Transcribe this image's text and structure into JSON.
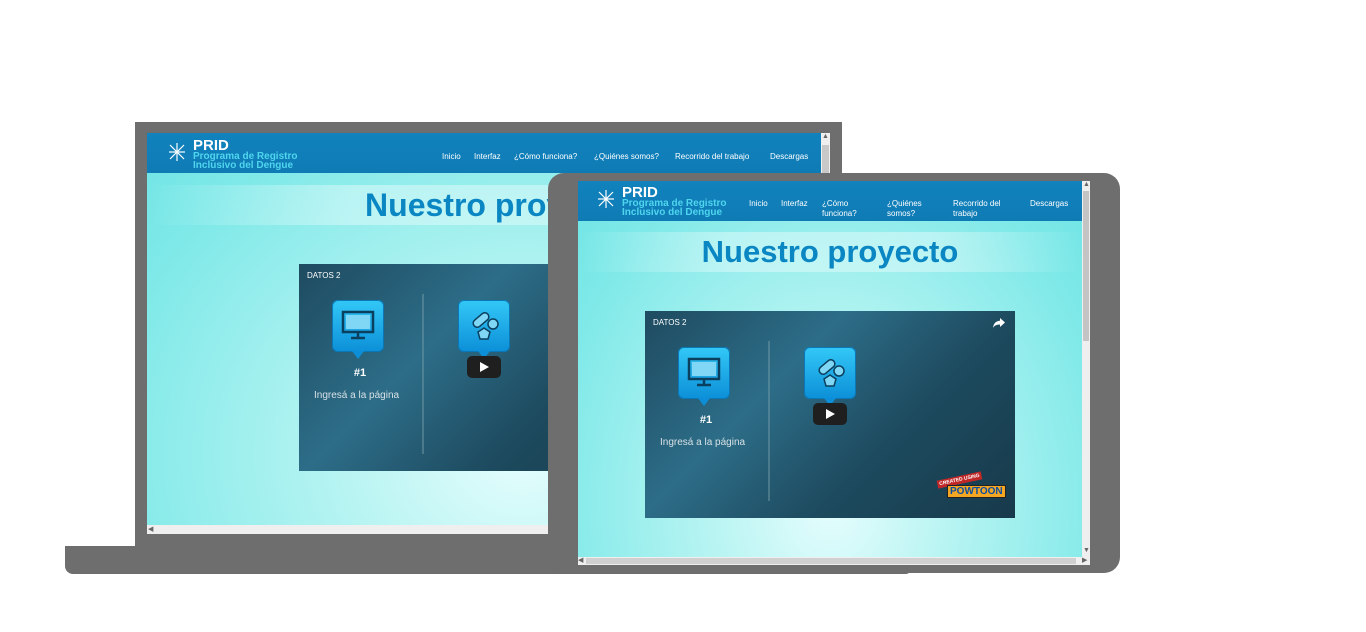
{
  "site": {
    "brand": "PRID",
    "subtitle_line1": "Programa de Registro",
    "subtitle_line2": "Inclusivo del Dengue",
    "nav": {
      "inicio": "Inicio",
      "interfaz": "Interfaz",
      "como": "¿Cómo funciona?",
      "quienes": "¿Quiénes somos?",
      "recorrido": "Recorrido del trabajo",
      "descargas": "Descargas"
    },
    "tablet_nav": {
      "como_l1": "¿Cómo",
      "como_l2": "funciona?",
      "quienes_l1": "¿Quiénes",
      "quienes_l2": "somos?",
      "recorrido_l1": "Recorrido del",
      "recorrido_l2": "trabajo"
    },
    "page_title_laptop": "Nuestro proye",
    "page_title": "Nuestro proyecto"
  },
  "video": {
    "title": "DATOS 2",
    "step_number": "#1",
    "step_text": "Ingresá a la página",
    "watermark_top": "CREATED USING",
    "watermark_brand": "POWTOON"
  },
  "icons": [
    "mosquito-logo-icon",
    "monitor-icon",
    "pills-icon",
    "play-icon",
    "share-icon"
  ],
  "colors": {
    "header": "#1182bd",
    "title": "#0a86c3",
    "page_bg": "#7ee9e8",
    "device_frame": "#6e6e6e",
    "tile_blue": "#1aa6ea"
  }
}
